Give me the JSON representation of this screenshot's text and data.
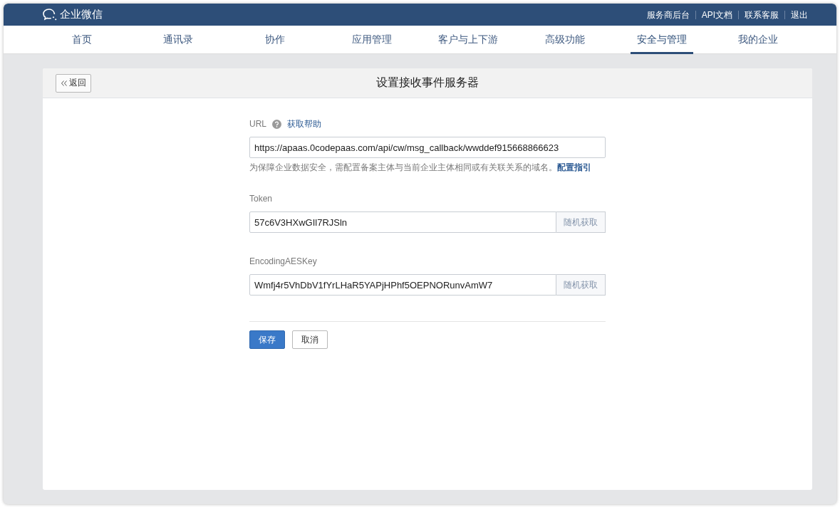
{
  "brand": {
    "name": "企业微信"
  },
  "top_links": [
    "服务商后台",
    "API文档",
    "联系客服",
    "退出"
  ],
  "nav": [
    {
      "label": "首页",
      "selected": false
    },
    {
      "label": "通讯录",
      "selected": false
    },
    {
      "label": "协作",
      "selected": false
    },
    {
      "label": "应用管理",
      "selected": false
    },
    {
      "label": "客户与上下游",
      "selected": false
    },
    {
      "label": "高级功能",
      "selected": false
    },
    {
      "label": "安全与管理",
      "selected": true
    },
    {
      "label": "我的企业",
      "selected": false
    }
  ],
  "page": {
    "back_button": "返回",
    "title": "设置接收事件服务器"
  },
  "form": {
    "fields": [
      {
        "kind": "url",
        "label": "URL",
        "help_link": "获取帮助",
        "value": "https://apaas.0codepaas.com/api/cw/msg_callback/wwddef915668866623",
        "hint": "为保障企业数据安全，需配置备案主体与当前企业主体相同或有关联关系的域名。",
        "hint_link": "配置指引"
      },
      {
        "kind": "random",
        "label": "Token",
        "value": "57c6V3HXwGIl7RJSln",
        "button": "随机获取"
      },
      {
        "kind": "random",
        "label": "EncodingAESKey",
        "value": "Wmfj4r5VhDbV1fYrLHaR5YAPjHPhf5OEPNORunvAmW7",
        "button": "随机获取"
      }
    ],
    "buttons": [
      {
        "label": "保存",
        "kind": "primary"
      },
      {
        "label": "取消",
        "kind": "default"
      }
    ]
  }
}
